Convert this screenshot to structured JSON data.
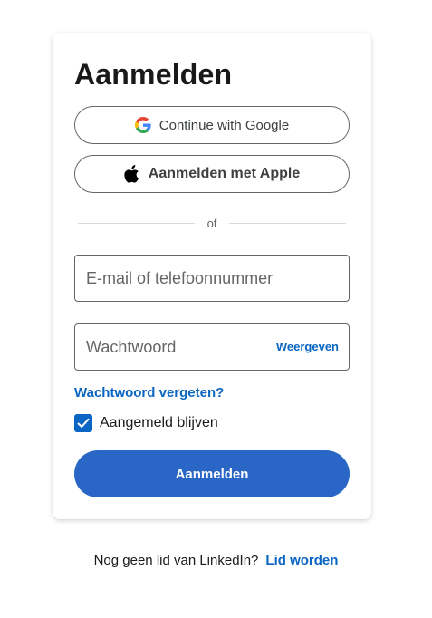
{
  "card": {
    "title": "Aanmelden",
    "google_label": "Continue with Google",
    "apple_label": "Aanmelden met Apple",
    "divider_text": "of",
    "email_placeholder": "E-mail of telefoonnummer",
    "email_value": "",
    "password_placeholder": "Wachtwoord",
    "password_value": "",
    "show_password_label": "Weergeven",
    "forgot_password_label": "Wachtwoord vergeten?",
    "remember_label": "Aangemeld blijven",
    "remember_checked": true,
    "submit_label": "Aanmelden"
  },
  "footer": {
    "prompt": "Nog geen lid van LinkedIn?",
    "join_label": "Lid worden"
  },
  "icons": {
    "google": "google-g-icon",
    "apple": "apple-logo-icon",
    "check": "checkmark-icon"
  },
  "colors": {
    "accent": "#0a66c2",
    "button": "#2a66c6",
    "border": "#666666"
  }
}
